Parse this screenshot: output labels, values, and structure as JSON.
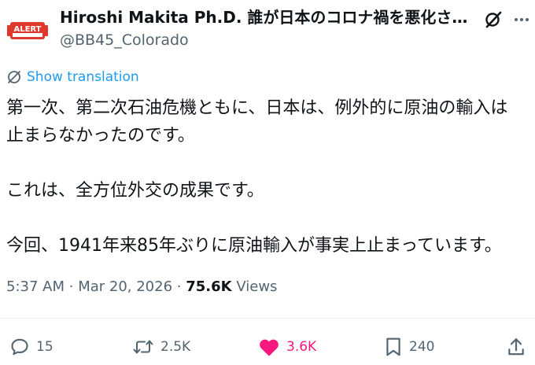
{
  "author": {
    "name": "Hiroshi Makita Ph.D. 誰が日本のコロナ禍を悪化さ…",
    "handle": "@BB45_Colorado",
    "avatar_text": "ALERT"
  },
  "translation": {
    "label": "Show translation"
  },
  "tweet": {
    "line1": "第一次、第二次石油危機ともに、日本は、例外的に原油の輸入は",
    "line2": "止まらなかったのです。",
    "line3": "これは、全方位外交の成果です。",
    "line4": "今回、1941年来85年ぶりに原油輸入が事実上止まっています。"
  },
  "meta": {
    "time": "5:37 AM",
    "separator": "·",
    "date": "Mar 20, 2026",
    "views_count": "75.6K",
    "views_label": "Views"
  },
  "actions": {
    "replies": "15",
    "reposts": "2.5K",
    "likes": "3.6K",
    "bookmarks": "240"
  },
  "colors": {
    "accent": "#1d9bf0",
    "like": "#f91880",
    "muted": "#536471",
    "text": "#0f1419",
    "avatar_red": "#e0392b"
  },
  "icons": {
    "grok": "grok-icon",
    "more": "more-icon",
    "translate": "translate-icon",
    "reply": "reply-icon",
    "repost": "repost-icon",
    "like": "heart-icon",
    "bookmark": "bookmark-icon",
    "share": "share-icon"
  }
}
